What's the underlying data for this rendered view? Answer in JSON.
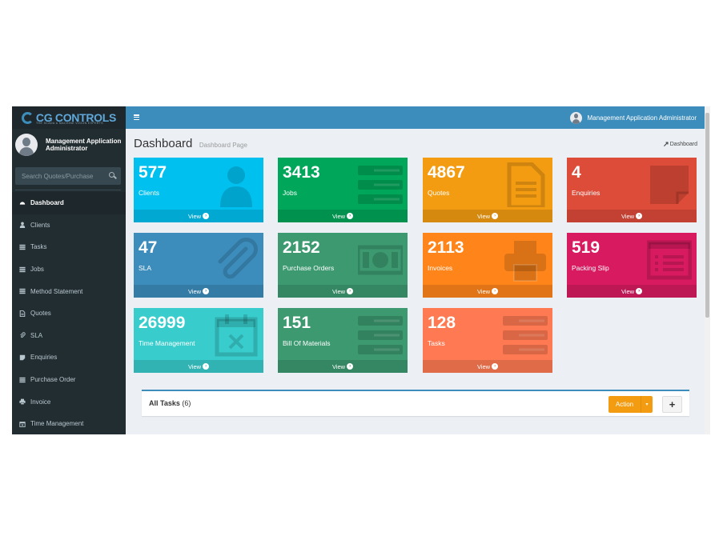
{
  "brand": {
    "name": "CG CONTROLS",
    "tagline": "THE SCADA & MACHINE VISION EXPERTS"
  },
  "sidebar": {
    "user_name": "Management Application Administrator",
    "search_placeholder": "Search Quotes/Purchase",
    "items": [
      {
        "label": "Dashboard",
        "icon": "dashboard-icon",
        "active": true
      },
      {
        "label": "Clients",
        "icon": "user-icon"
      },
      {
        "label": "Tasks",
        "icon": "list-icon"
      },
      {
        "label": "Jobs",
        "icon": "list-icon"
      },
      {
        "label": "Method Statement",
        "icon": "list-icon"
      },
      {
        "label": "Quotes",
        "icon": "file-icon"
      },
      {
        "label": "SLA",
        "icon": "paperclip-icon"
      },
      {
        "label": "Enquiries",
        "icon": "sticky-note-icon"
      },
      {
        "label": "Purchase Order",
        "icon": "list-icon"
      },
      {
        "label": "Invoice",
        "icon": "print-icon"
      },
      {
        "label": "Time Management",
        "icon": "calendar-icon"
      }
    ]
  },
  "header": {
    "user_name": "Management Application Administrator"
  },
  "content": {
    "title": "Dashboard",
    "subtitle": "Dashboard Page",
    "breadcrumb": "Dashboard"
  },
  "boxes": [
    {
      "count": "577",
      "label": "Clients",
      "link": "View",
      "color": "#00c0ef",
      "icon": "user-icon"
    },
    {
      "count": "3413",
      "label": "Jobs",
      "link": "View",
      "color": "#00a65a",
      "icon": "list-icon"
    },
    {
      "count": "4867",
      "label": "Quotes",
      "link": "View",
      "color": "#f39c12",
      "icon": "file-icon"
    },
    {
      "count": "4",
      "label": "Enquiries",
      "link": "View",
      "color": "#dd4b39",
      "icon": "sticky-note-icon"
    },
    {
      "count": "47",
      "label": "SLA",
      "link": "View",
      "color": "#3c8dbc",
      "icon": "paperclip-icon"
    },
    {
      "count": "2152",
      "label": "Purchase Orders",
      "link": "View",
      "color": "#3d9970",
      "icon": "money-icon"
    },
    {
      "count": "2113",
      "label": "Invoices",
      "link": "View",
      "color": "#ff851b",
      "icon": "print-icon"
    },
    {
      "count": "519",
      "label": "Packing Slip",
      "link": "View",
      "color": "#d81b60",
      "icon": "list-alt-icon"
    },
    {
      "count": "26999",
      "label": "Time Management",
      "link": "View",
      "color": "#39cccc",
      "icon": "calendar-icon"
    },
    {
      "count": "151",
      "label": "Bill Of Materials",
      "link": "View",
      "color": "#3d9970",
      "icon": "list-icon"
    },
    {
      "count": "128",
      "label": "Tasks",
      "link": "View",
      "color": "#ff7a52",
      "icon": "list-icon"
    }
  ],
  "tasks_panel": {
    "title": "All Tasks",
    "count": "(6)",
    "action_label": "Action",
    "add_label": "+"
  }
}
